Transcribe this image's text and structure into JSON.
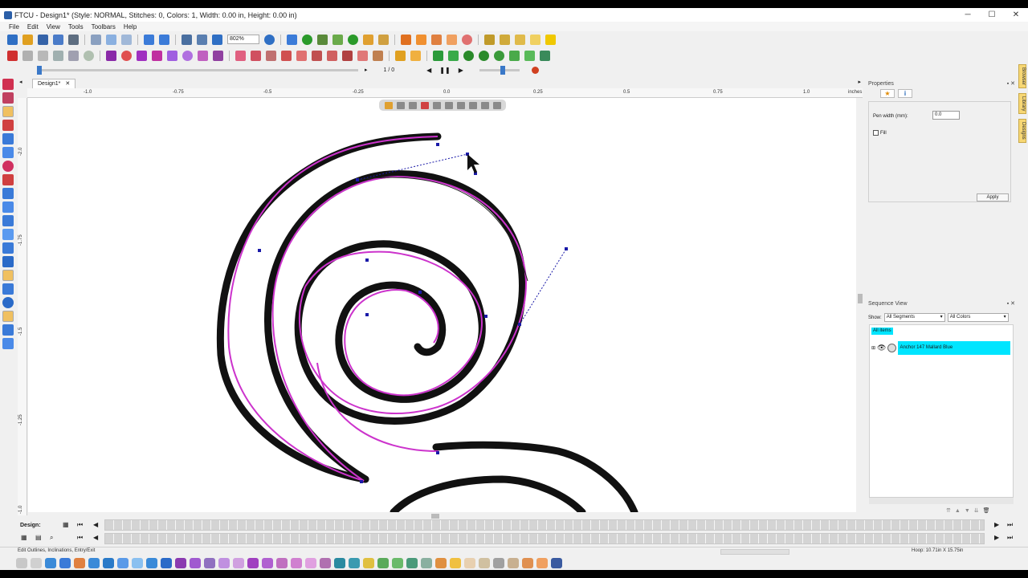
{
  "window": {
    "title": "FTCU - Design1* (Style: NORMAL, Stitches: 0, Colors: 1, Width: 0.00 in, Height: 0.00 in)",
    "minimize": "─",
    "maximize": "☐",
    "close": "✕"
  },
  "menu": [
    "File",
    "Edit",
    "View",
    "Tools",
    "Toolbars",
    "Help"
  ],
  "toolbar": {
    "zoom_value": "802%",
    "frame_count": "1 / 0"
  },
  "document_tab": {
    "label": "Design1*",
    "close": "✕"
  },
  "ruler": {
    "top_ticks": [
      "-1.0",
      "-0.75",
      "-0.5",
      "-0.25",
      "0.0",
      "0.25",
      "0.5",
      "0.75",
      "1.0"
    ],
    "top_unit": "inches",
    "left_ticks": [
      "-2.0",
      "-1.75",
      "-1.5",
      "-1.25",
      "-1.0"
    ],
    "left_unit": "inches"
  },
  "properties": {
    "title": "Properties",
    "pen_width_label": "Pen width (mm):",
    "pen_width_value": "0.0",
    "fill_label": "Fill",
    "apply_label": "Apply"
  },
  "sequence": {
    "title": "Sequence View",
    "show_label": "Show:",
    "segments_value": "All Segments",
    "colors_value": "All Colors",
    "all_items_label": "All items",
    "thread_label": "Anchor 147 Mallard Blue"
  },
  "side_tabs": [
    "Browser",
    "Library",
    "Designs"
  ],
  "bottom": {
    "design_label": "Design:"
  },
  "status": {
    "hint": "Edit Outlines, Inclinations, Entry/Exit",
    "hoop": "Hoop: 10.71in X 15.75in"
  },
  "colors": {
    "accent": "#00e5ff",
    "curve": "#cc33cc",
    "node": "#1a1aa8",
    "stitch": "#111111"
  }
}
